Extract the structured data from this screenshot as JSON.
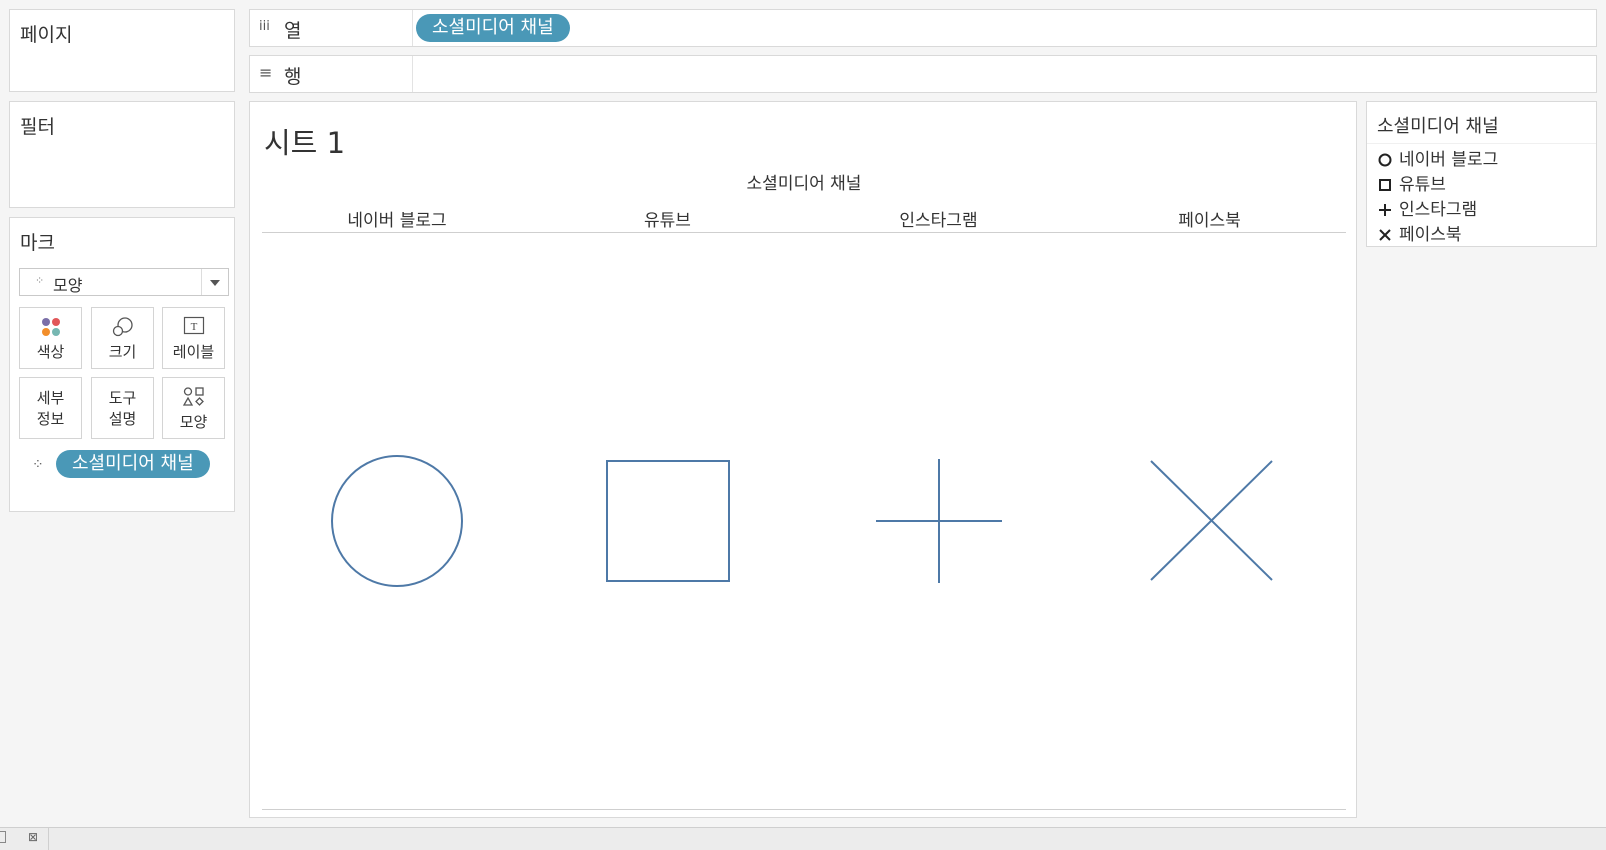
{
  "panels": {
    "pages_title": "페이지",
    "filters_title": "필터",
    "marks_title": "마크"
  },
  "shelves": {
    "columns": {
      "icon": "iii",
      "label": "열",
      "pill": "소셜미디어 채널"
    },
    "rows": {
      "icon": "≡",
      "label": "행"
    }
  },
  "marks": {
    "mark_type": "모양",
    "buttons": {
      "color": "색상",
      "size": "크기",
      "label": "레이블",
      "detail_line1": "세부",
      "detail_line2": "정보",
      "tooltip_line1": "도구",
      "tooltip_line2": "설명",
      "shape": "모양"
    },
    "field_pill": "소셜미디어 채널"
  },
  "sheet": {
    "title": "시트 1",
    "column_header": "소셜미디어 채널",
    "categories": [
      "네이버 블로그",
      "유튜브",
      "인스타그램",
      "페이스북"
    ]
  },
  "legend": {
    "title": "소셜미디어 채널",
    "items": [
      {
        "shape": "circle",
        "label": "네이버 블로그"
      },
      {
        "shape": "square",
        "label": "유튜브"
      },
      {
        "shape": "plus",
        "label": "인스타그램"
      },
      {
        "shape": "cross",
        "label": "페이스북"
      }
    ]
  },
  "colors": {
    "pill": "#4a98b7",
    "mark": "#4e79a7"
  }
}
